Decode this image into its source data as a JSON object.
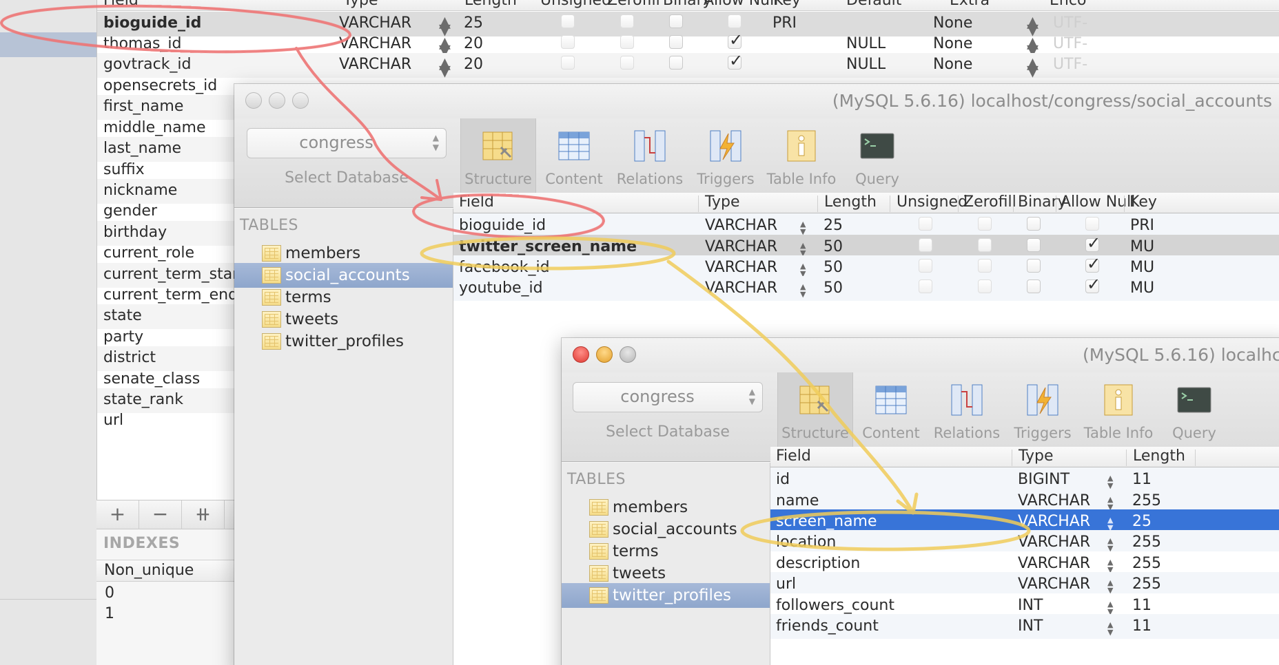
{
  "bg_window": {
    "header": [
      "Field",
      "Type",
      "Length",
      "Unsigned",
      "Zerofill",
      "Binary",
      "Allow Null",
      "Key",
      "Default",
      "Extra",
      "Enco"
    ],
    "rows": [
      {
        "field": "bioguide_id",
        "type": "VARCHAR",
        "length": "25",
        "key": "PRI",
        "default": "",
        "extra": "None",
        "enc": "UTF-",
        "null": false
      },
      {
        "field": "thomas_id",
        "type": "VARCHAR",
        "length": "20",
        "key": "",
        "default": "NULL",
        "extra": "None",
        "enc": "UTF-",
        "null": true
      },
      {
        "field": "govtrack_id",
        "type": "VARCHAR",
        "length": "20",
        "key": "",
        "default": "NULL",
        "extra": "None",
        "enc": "UTF-",
        "null": true
      }
    ],
    "more_fields": [
      "opensecrets_id",
      "first_name",
      "middle_name",
      "last_name",
      "suffix",
      "nickname",
      "gender",
      "birthday",
      "current_role",
      "current_term_start",
      "current_term_end",
      "state",
      "party",
      "district",
      "senate_class",
      "state_rank",
      "url"
    ],
    "buttons": {
      "add": "+",
      "remove": "−",
      "duplicate": "⧺"
    },
    "indexes_heading": "INDEXES",
    "index_column": "Non_unique",
    "index_values": [
      "0",
      "1"
    ]
  },
  "win2": {
    "title": "(MySQL 5.6.16) localhost/congress/social_accounts",
    "database": "congress",
    "database_label": "Select Database",
    "tools": [
      "Structure",
      "Content",
      "Relations",
      "Triggers",
      "Table Info",
      "Query"
    ],
    "tables_heading": "TABLES",
    "tables": [
      "members",
      "social_accounts",
      "terms",
      "tweets",
      "twitter_profiles"
    ],
    "header": [
      "Field",
      "Type",
      "Length",
      "Unsigned",
      "Zerofill",
      "Binary",
      "Allow Null",
      "Key"
    ],
    "rows": [
      {
        "field": "bioguide_id",
        "type": "VARCHAR",
        "length": "25",
        "key": "PRI",
        "null": false
      },
      {
        "field": "twitter_screen_name",
        "type": "VARCHAR",
        "length": "50",
        "key": "MU",
        "null": true
      },
      {
        "field": "facebook_id",
        "type": "VARCHAR",
        "length": "50",
        "key": "MU",
        "null": true
      },
      {
        "field": "youtube_id",
        "type": "VARCHAR",
        "length": "50",
        "key": "MU",
        "null": true
      }
    ]
  },
  "win3": {
    "title": "(MySQL 5.6.16) localhc",
    "database": "congress",
    "database_label": "Select Database",
    "tools": [
      "Structure",
      "Content",
      "Relations",
      "Triggers",
      "Table Info",
      "Query"
    ],
    "tables_heading": "TABLES",
    "tables": [
      "members",
      "social_accounts",
      "terms",
      "tweets",
      "twitter_profiles"
    ],
    "header": [
      "Field",
      "Type",
      "Length"
    ],
    "rows": [
      {
        "field": "id",
        "type": "BIGINT",
        "length": "11"
      },
      {
        "field": "name",
        "type": "VARCHAR",
        "length": "255"
      },
      {
        "field": "screen_name",
        "type": "VARCHAR",
        "length": "25"
      },
      {
        "field": "location",
        "type": "VARCHAR",
        "length": "255"
      },
      {
        "field": "description",
        "type": "VARCHAR",
        "length": "255"
      },
      {
        "field": "url",
        "type": "VARCHAR",
        "length": "255"
      },
      {
        "field": "followers_count",
        "type": "INT",
        "length": "11"
      },
      {
        "field": "friends_count",
        "type": "INT",
        "length": "11"
      }
    ]
  },
  "colors": {
    "selection_blue": "#3874d8",
    "annotation_red": "#ee7474",
    "annotation_yellow": "#f0cc5a"
  }
}
